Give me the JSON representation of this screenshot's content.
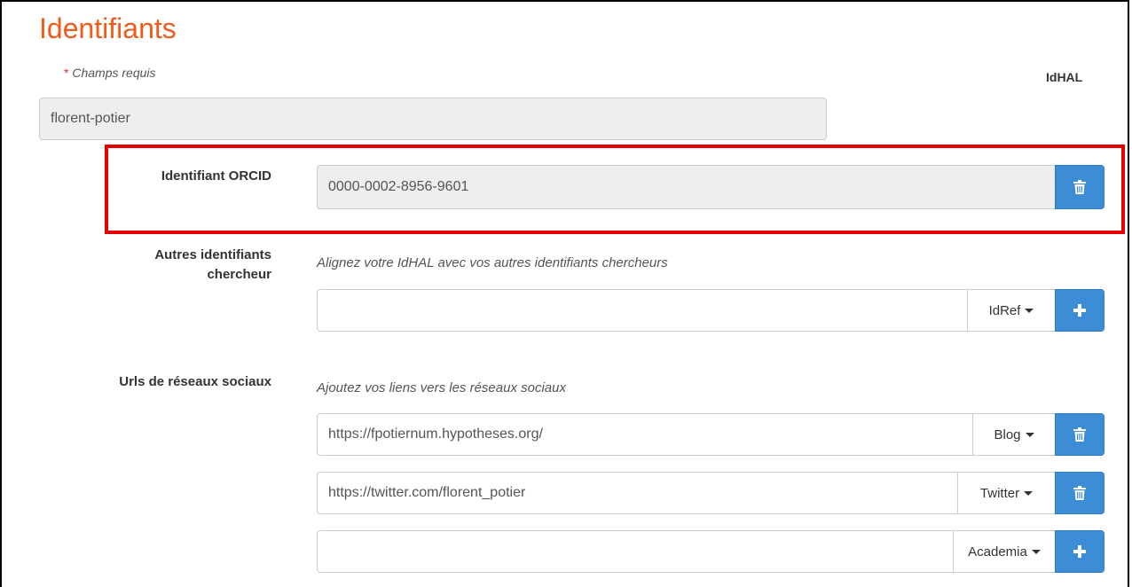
{
  "section": {
    "title": "Identifiants",
    "required_star": "*",
    "required_text": "Champs requis",
    "idhal_label": "IdHAL"
  },
  "idhal": {
    "value": "florent-potier"
  },
  "orcid": {
    "label": "Identifiant ORCID",
    "value": "0000-0002-8956-9601"
  },
  "other_ids": {
    "label_line1": "Autres identifiants",
    "label_line2": "chercheur",
    "hint": "Alignez votre IdHAL avec vos autres identifiants chercheurs",
    "value": "",
    "type": "IdRef"
  },
  "social": {
    "label": "Urls de réseaux sociaux",
    "hint": "Ajoutez vos liens vers les réseaux sociaux",
    "rows": [
      {
        "value": "https://fpotiernum.hypotheses.org/",
        "type": "Blog"
      },
      {
        "value": "https://twitter.com/florent_potier",
        "type": "Twitter"
      },
      {
        "value": "",
        "type": "Academia"
      }
    ]
  },
  "colors": {
    "title": "#f05a1a",
    "button": "#3c8dd6",
    "highlight": "#e50000"
  },
  "icons": {
    "delete": "trash-icon",
    "add": "plus-icon",
    "dropdown": "caret-down-icon"
  }
}
